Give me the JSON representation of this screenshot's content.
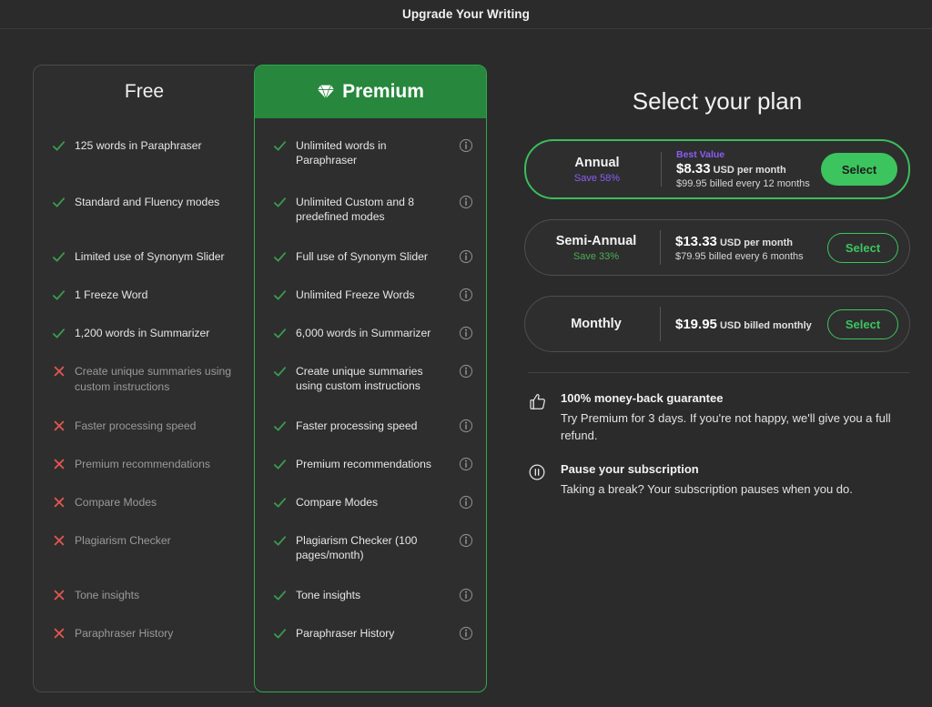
{
  "header": {
    "title": "Upgrade Your Writing"
  },
  "compare": {
    "free": {
      "name": "Free",
      "features": [
        {
          "text": "125 words in Paraphraser",
          "included": true
        },
        {
          "text": "Standard and Fluency modes",
          "included": true
        },
        {
          "text": "Limited use of Synonym Slider",
          "included": true
        },
        {
          "text": "1 Freeze Word",
          "included": true
        },
        {
          "text": "1,200 words in Summarizer",
          "included": true
        },
        {
          "text": "Create unique summaries using custom instructions",
          "included": false
        },
        {
          "text": "Faster processing speed",
          "included": false
        },
        {
          "text": "Premium recommendations",
          "included": false
        },
        {
          "text": "Compare Modes",
          "included": false
        },
        {
          "text": "Plagiarism Checker",
          "included": false
        },
        {
          "text": "Tone insights",
          "included": false
        },
        {
          "text": "Paraphraser History",
          "included": false
        }
      ]
    },
    "premium": {
      "name": "Premium",
      "icon": "gem-icon",
      "features": [
        {
          "text": "Unlimited words in Paraphraser",
          "included": true,
          "info": true
        },
        {
          "text": "Unlimited Custom and 8 predefined modes",
          "included": true,
          "info": true
        },
        {
          "text": "Full use of Synonym Slider",
          "included": true,
          "info": true
        },
        {
          "text": "Unlimited Freeze Words",
          "included": true,
          "info": true
        },
        {
          "text": "6,000 words in Summarizer",
          "included": true,
          "info": true
        },
        {
          "text": "Create unique summaries using custom instructions",
          "included": true,
          "info": true
        },
        {
          "text": "Faster processing speed",
          "included": true,
          "info": true
        },
        {
          "text": "Premium recommendations",
          "included": true,
          "info": true
        },
        {
          "text": "Compare Modes",
          "included": true,
          "info": true
        },
        {
          "text": "Plagiarism Checker (100 pages/month)",
          "included": true,
          "info": true
        },
        {
          "text": "Tone insights",
          "included": true,
          "info": true
        },
        {
          "text": "Paraphraser History",
          "included": true,
          "info": true
        }
      ]
    }
  },
  "plans": {
    "title": "Select your plan",
    "items": [
      {
        "name": "Annual",
        "save": "Save 58%",
        "badge": "Best Value",
        "price": "$8.33",
        "price_unit": "USD per month",
        "billing": "$99.95 billed every 12 months",
        "button": "Select",
        "selected": true
      },
      {
        "name": "Semi-Annual",
        "save": "Save 33%",
        "badge": "",
        "price": "$13.33",
        "price_unit": "USD per month",
        "billing": "$79.95 billed every 6 months",
        "button": "Select",
        "selected": false
      },
      {
        "name": "Monthly",
        "save": "",
        "badge": "",
        "price": "$19.95",
        "price_unit": "USD billed monthly",
        "billing": "",
        "button": "Select",
        "selected": false
      }
    ]
  },
  "promises": [
    {
      "icon": "thumbs-up-icon",
      "heading": "100% money-back guarantee",
      "body": "Try Premium for 3 days. If you're not happy, we'll give you a full refund."
    },
    {
      "icon": "pause-circle-icon",
      "heading": "Pause your subscription",
      "body": "Taking a break? Your subscription pauses when you do."
    }
  ],
  "colors": {
    "background": "#2b2b2b",
    "card": "#2e2e2e",
    "premium_header": "#26873d",
    "accent_green": "#3cc45e",
    "check_green": "#3a9a4f",
    "cross_red": "#e2554f",
    "badge_purple": "#8b5cf6"
  }
}
